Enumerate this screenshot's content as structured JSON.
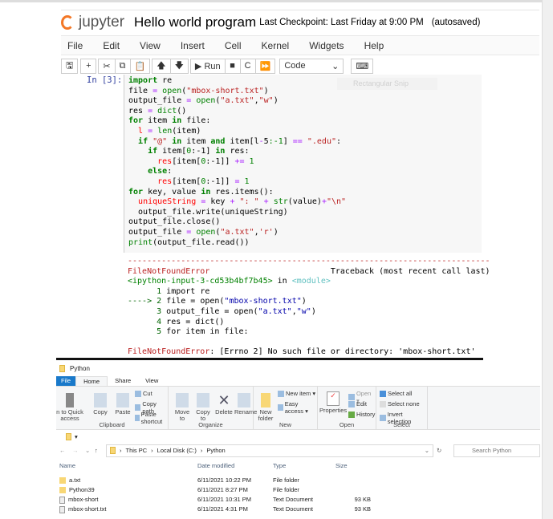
{
  "jupyter": {
    "logo_text": "jupyter",
    "notebook_title": "Hello world program",
    "checkpoint": "Last Checkpoint: Last Friday at 9:00 PM",
    "autosave": "(autosaved)"
  },
  "menu": [
    "File",
    "Edit",
    "View",
    "Insert",
    "Cell",
    "Kernel",
    "Widgets",
    "Help"
  ],
  "toolbar": {
    "save": "🖫",
    "add": "+",
    "cut": "✂",
    "copy": "⧉",
    "paste": "📋",
    "up": "🡅",
    "down": "🡇",
    "run": "▶ Run",
    "stop": "■",
    "restart": "C",
    "fast_forward": "⏩",
    "cell_type": "Code",
    "keyboard": "⌨"
  },
  "cell": {
    "prompt": "In [3]:",
    "overlay": "Rectangular Snip",
    "code": [
      [
        [
          "import",
          "k"
        ],
        [
          " re",
          ""
        ]
      ],
      [
        [
          "file ",
          ""
        ],
        [
          "=",
          "o"
        ],
        [
          " ",
          ""
        ],
        [
          "open",
          "b"
        ],
        [
          "(",
          ""
        ],
        [
          "\"mbox-short.txt\"",
          "s"
        ],
        [
          ")",
          ""
        ]
      ],
      [
        [
          "output_file ",
          ""
        ],
        [
          "=",
          "o"
        ],
        [
          " ",
          ""
        ],
        [
          "open",
          "b"
        ],
        [
          "(",
          ""
        ],
        [
          "\"a.txt\"",
          "s"
        ],
        [
          ",",
          ""
        ],
        [
          "\"w\"",
          "s"
        ],
        [
          ")",
          ""
        ]
      ],
      [
        [
          "res ",
          ""
        ],
        [
          "=",
          "o"
        ],
        [
          " ",
          ""
        ],
        [
          "dict",
          "b"
        ],
        [
          "()",
          ""
        ]
      ],
      [
        [
          "for",
          "k"
        ],
        [
          " item ",
          ""
        ],
        [
          "in",
          "k"
        ],
        [
          " file:",
          ""
        ]
      ],
      [
        [
          "  ",
          ""
        ],
        [
          "l",
          "v"
        ],
        [
          " ",
          ""
        ],
        [
          "=",
          "o"
        ],
        [
          " ",
          ""
        ],
        [
          "len",
          "b"
        ],
        [
          "(item)",
          ""
        ]
      ],
      [
        [
          "  ",
          ""
        ],
        [
          "if",
          "k"
        ],
        [
          " ",
          ""
        ],
        [
          "\"@\"",
          "s"
        ],
        [
          " ",
          ""
        ],
        [
          "in",
          "k"
        ],
        [
          " item ",
          ""
        ],
        [
          "and",
          "k"
        ],
        [
          " item[l",
          ""
        ],
        [
          "-",
          "o"
        ],
        [
          "5",
          ""
        ],
        [
          ":-1",
          "n"
        ],
        [
          "] ",
          ""
        ],
        [
          "==",
          "o"
        ],
        [
          " ",
          ""
        ],
        [
          "\".edu\"",
          "s"
        ],
        [
          ":",
          ""
        ]
      ],
      [
        [
          "    ",
          ""
        ],
        [
          "if",
          "k"
        ],
        [
          " item[",
          ""
        ],
        [
          "0",
          "n"
        ],
        [
          ":-1] ",
          ""
        ],
        [
          "in",
          "k"
        ],
        [
          " res:",
          ""
        ]
      ],
      [
        [
          "      ",
          ""
        ],
        [
          "res",
          "v"
        ],
        [
          "[item[",
          ""
        ],
        [
          "0",
          "n"
        ],
        [
          ":-1]] ",
          ""
        ],
        [
          "+=",
          "o"
        ],
        [
          " ",
          ""
        ],
        [
          "1",
          "n"
        ]
      ],
      [
        [
          "    ",
          ""
        ],
        [
          "else",
          "k"
        ],
        [
          ":",
          ""
        ]
      ],
      [
        [
          "      ",
          ""
        ],
        [
          "res",
          "v"
        ],
        [
          "[item[",
          ""
        ],
        [
          "0",
          "n"
        ],
        [
          ":-1]] ",
          ""
        ],
        [
          "=",
          "o"
        ],
        [
          " ",
          ""
        ],
        [
          "1",
          "n"
        ]
      ],
      [
        [
          "for",
          "k"
        ],
        [
          " key, value ",
          ""
        ],
        [
          "in",
          "k"
        ],
        [
          " res.items():",
          ""
        ]
      ],
      [
        [
          "  ",
          ""
        ],
        [
          "uniqueString",
          "v"
        ],
        [
          " ",
          ""
        ],
        [
          "=",
          "o"
        ],
        [
          " key ",
          ""
        ],
        [
          "+",
          "o"
        ],
        [
          " ",
          ""
        ],
        [
          "\": \"",
          "s"
        ],
        [
          " ",
          ""
        ],
        [
          "+",
          "o"
        ],
        [
          " ",
          ""
        ],
        [
          "str",
          "b"
        ],
        [
          "(value)",
          ""
        ],
        [
          "+",
          "o"
        ],
        [
          "\"\\n\"",
          "s"
        ]
      ],
      [
        [
          "  output_file.write(uniqueString)",
          ""
        ]
      ],
      [
        [
          "output_file.close()",
          ""
        ]
      ],
      [
        [
          "output_file ",
          ""
        ],
        [
          "=",
          "o"
        ],
        [
          " ",
          ""
        ],
        [
          "open",
          "b"
        ],
        [
          "(",
          ""
        ],
        [
          "\"a.txt\"",
          "s"
        ],
        [
          ",",
          ""
        ],
        [
          "'r'",
          "s"
        ],
        [
          ")",
          ""
        ]
      ],
      [
        [
          "print",
          "b"
        ],
        [
          "(output_file.read())",
          ""
        ]
      ]
    ]
  },
  "output": [
    [
      [
        "---------------------------------------------------------------------------",
        "er"
      ]
    ],
    [
      [
        "FileNotFoundError",
        "er"
      ],
      [
        "                         Traceback (most recent call last)",
        ""
      ]
    ],
    [
      [
        "<ipython-input-3-cd53b4bf7b45>",
        "gr"
      ],
      [
        " in ",
        ""
      ],
      [
        "<module>",
        "cy"
      ]
    ],
    [
      [
        "      1 ",
        "dg"
      ],
      [
        "import re",
        ""
      ]
    ],
    [
      [
        "----> 2 ",
        "dg"
      ],
      [
        "file = open(",
        ""
      ],
      [
        "\"mbox-short.txt\"",
        "bl"
      ],
      [
        ")",
        ""
      ]
    ],
    [
      [
        "      3 ",
        "dg"
      ],
      [
        "output_file = open(",
        ""
      ],
      [
        "\"a.txt\"",
        "bl"
      ],
      [
        ",",
        ""
      ],
      [
        "\"w\"",
        "bl"
      ],
      [
        ")",
        ""
      ]
    ],
    [
      [
        "      4 ",
        "dg"
      ],
      [
        "res = dict()",
        ""
      ]
    ],
    [
      [
        "      5 ",
        "dg"
      ],
      [
        "for item in file:",
        ""
      ]
    ],
    [
      [
        "",
        ""
      ]
    ],
    [
      [
        "FileNotFoundError",
        "er"
      ],
      [
        ": [Errno 2] No such file or directory: 'mbox-short.txt'",
        ""
      ]
    ]
  ],
  "explorer": {
    "title": "Python",
    "tabs": [
      "File",
      "Home",
      "Share",
      "View"
    ],
    "clipboard": {
      "pin": "n to Quick access",
      "copy": "Copy",
      "paste": "Paste",
      "cut": "Cut",
      "copy_path": "Copy path",
      "paste_shortcut": "Paste shortcut",
      "label": "Clipboard"
    },
    "organize": {
      "move": "Move to",
      "copy": "Copy to",
      "delete": "Delete",
      "rename": "Rename",
      "label": "Organize"
    },
    "new": {
      "folder": "New folder",
      "item": "New item ▾",
      "easy": "Easy access ▾",
      "label": "New"
    },
    "open": {
      "properties": "Properties",
      "open": "Open ▾",
      "edit": "Edit",
      "history": "History",
      "label": "Open"
    },
    "select": {
      "all": "Select all",
      "none": "Select none",
      "invert": "Invert selection",
      "label": "Select"
    },
    "breadcrumb": [
      "This PC",
      "Local Disk (C:)",
      "Python"
    ],
    "search_placeholder": "Search Python",
    "columns": [
      "Name",
      "Date modified",
      "Type",
      "Size"
    ],
    "files": [
      {
        "name": "a.txt",
        "date": "6/11/2021 10:22 PM",
        "type": "File folder",
        "size": "",
        "kind": "folder"
      },
      {
        "name": "Python39",
        "date": "6/11/2021 8:27 PM",
        "type": "File folder",
        "size": "",
        "kind": "folder"
      },
      {
        "name": "mbox-short",
        "date": "6/11/2021 10:31 PM",
        "type": "Text Document",
        "size": "93 KB",
        "kind": "doc"
      },
      {
        "name": "mbox-short.txt",
        "date": "6/11/2021 4:31 PM",
        "type": "Text Document",
        "size": "93 KB",
        "kind": "doc"
      }
    ]
  }
}
